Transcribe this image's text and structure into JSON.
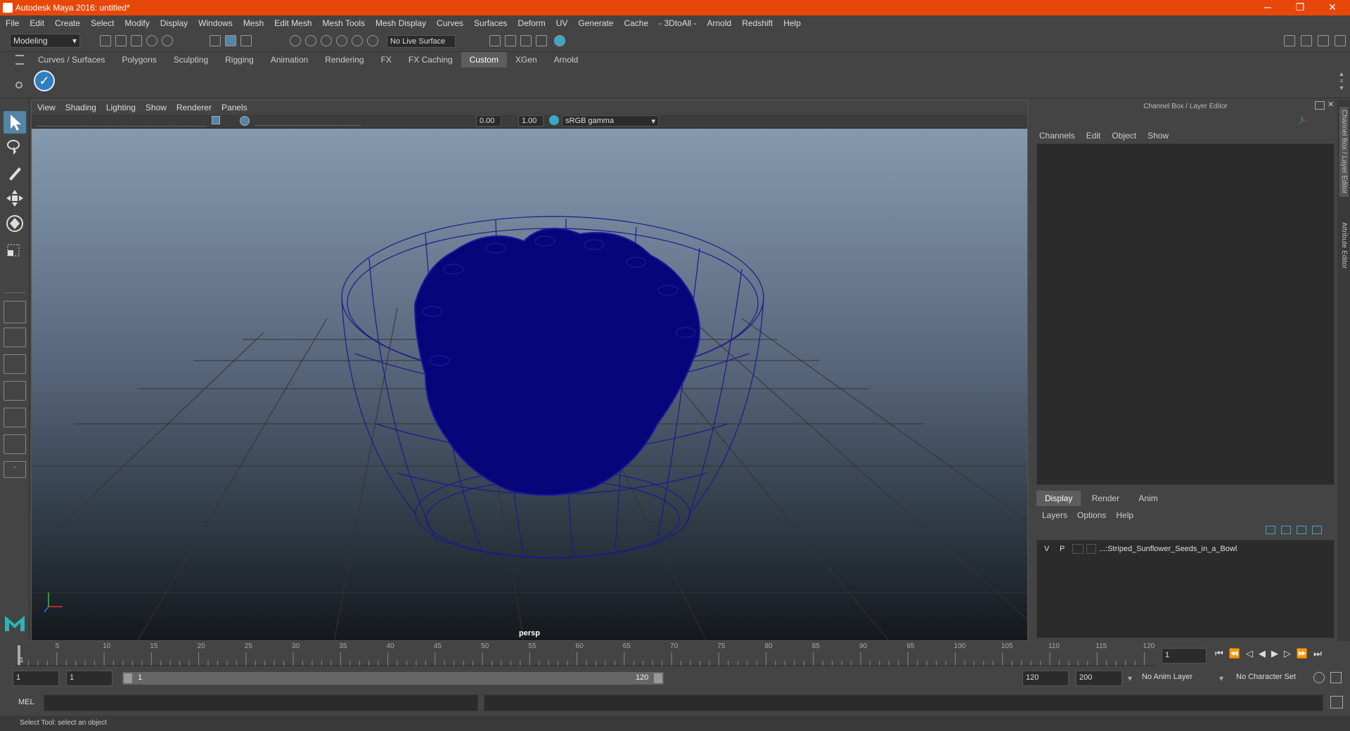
{
  "window": {
    "title": "Autodesk Maya 2016: untitled*",
    "minimize": "─",
    "maximize": "❐",
    "close": "✕"
  },
  "menus": [
    "File",
    "Edit",
    "Create",
    "Select",
    "Modify",
    "Display",
    "Windows",
    "Mesh",
    "Edit Mesh",
    "Mesh Tools",
    "Mesh Display",
    "Curves",
    "Surfaces",
    "Deform",
    "UV",
    "Generate",
    "Cache",
    "- 3DtoAll -",
    "Arnold",
    "Redshift",
    "Help"
  ],
  "status": {
    "mode": "Modeling",
    "live_surface": "No Live Surface"
  },
  "shelf_tabs": [
    "Curves / Surfaces",
    "Polygons",
    "Sculpting",
    "Rigging",
    "Animation",
    "Rendering",
    "FX",
    "FX Caching",
    "Custom",
    "XGen",
    "Arnold"
  ],
  "shelf_active": "Custom",
  "viewport": {
    "menus": [
      "View",
      "Shading",
      "Lighting",
      "Show",
      "Renderer",
      "Panels"
    ],
    "exposure": "0.00",
    "gamma": "1.00",
    "color_space": "sRGB gamma",
    "camera": "persp"
  },
  "channel_box": {
    "title": "Channel Box / Layer Editor",
    "menus": [
      "Channels",
      "Edit",
      "Object",
      "Show"
    ]
  },
  "layer_editor": {
    "tabs": [
      "Display",
      "Render",
      "Anim"
    ],
    "active_tab": "Display",
    "menus": [
      "Layers",
      "Options",
      "Help"
    ],
    "layers": [
      {
        "v": "V",
        "p": "P",
        "name": "...:Striped_Sunflower_Seeds_in_a_Bowl"
      }
    ]
  },
  "side_tabs": [
    "Channel Box / Layer Editor",
    "Attribute Editor"
  ],
  "timeline": {
    "ticks": [
      "5",
      "10",
      "15",
      "20",
      "25",
      "30",
      "35",
      "40",
      "45",
      "50",
      "55",
      "60",
      "65",
      "70",
      "75",
      "80",
      "85",
      "90",
      "95",
      "100",
      "105",
      "110",
      "115",
      "120"
    ],
    "start_label": "1",
    "current_frame": "1"
  },
  "range": {
    "start": "1",
    "playback_start": "1",
    "slider_start": "1",
    "slider_end": "120",
    "playback_end": "120",
    "end": "200",
    "anim_layer": "No Anim Layer",
    "character_set": "No Character Set"
  },
  "command": {
    "label": "MEL"
  },
  "help_line": "Select Tool: select an object",
  "colors": {
    "titlebar": "#e8470a",
    "wire": "#1a1a8c",
    "active_tool": "#5285a6"
  }
}
